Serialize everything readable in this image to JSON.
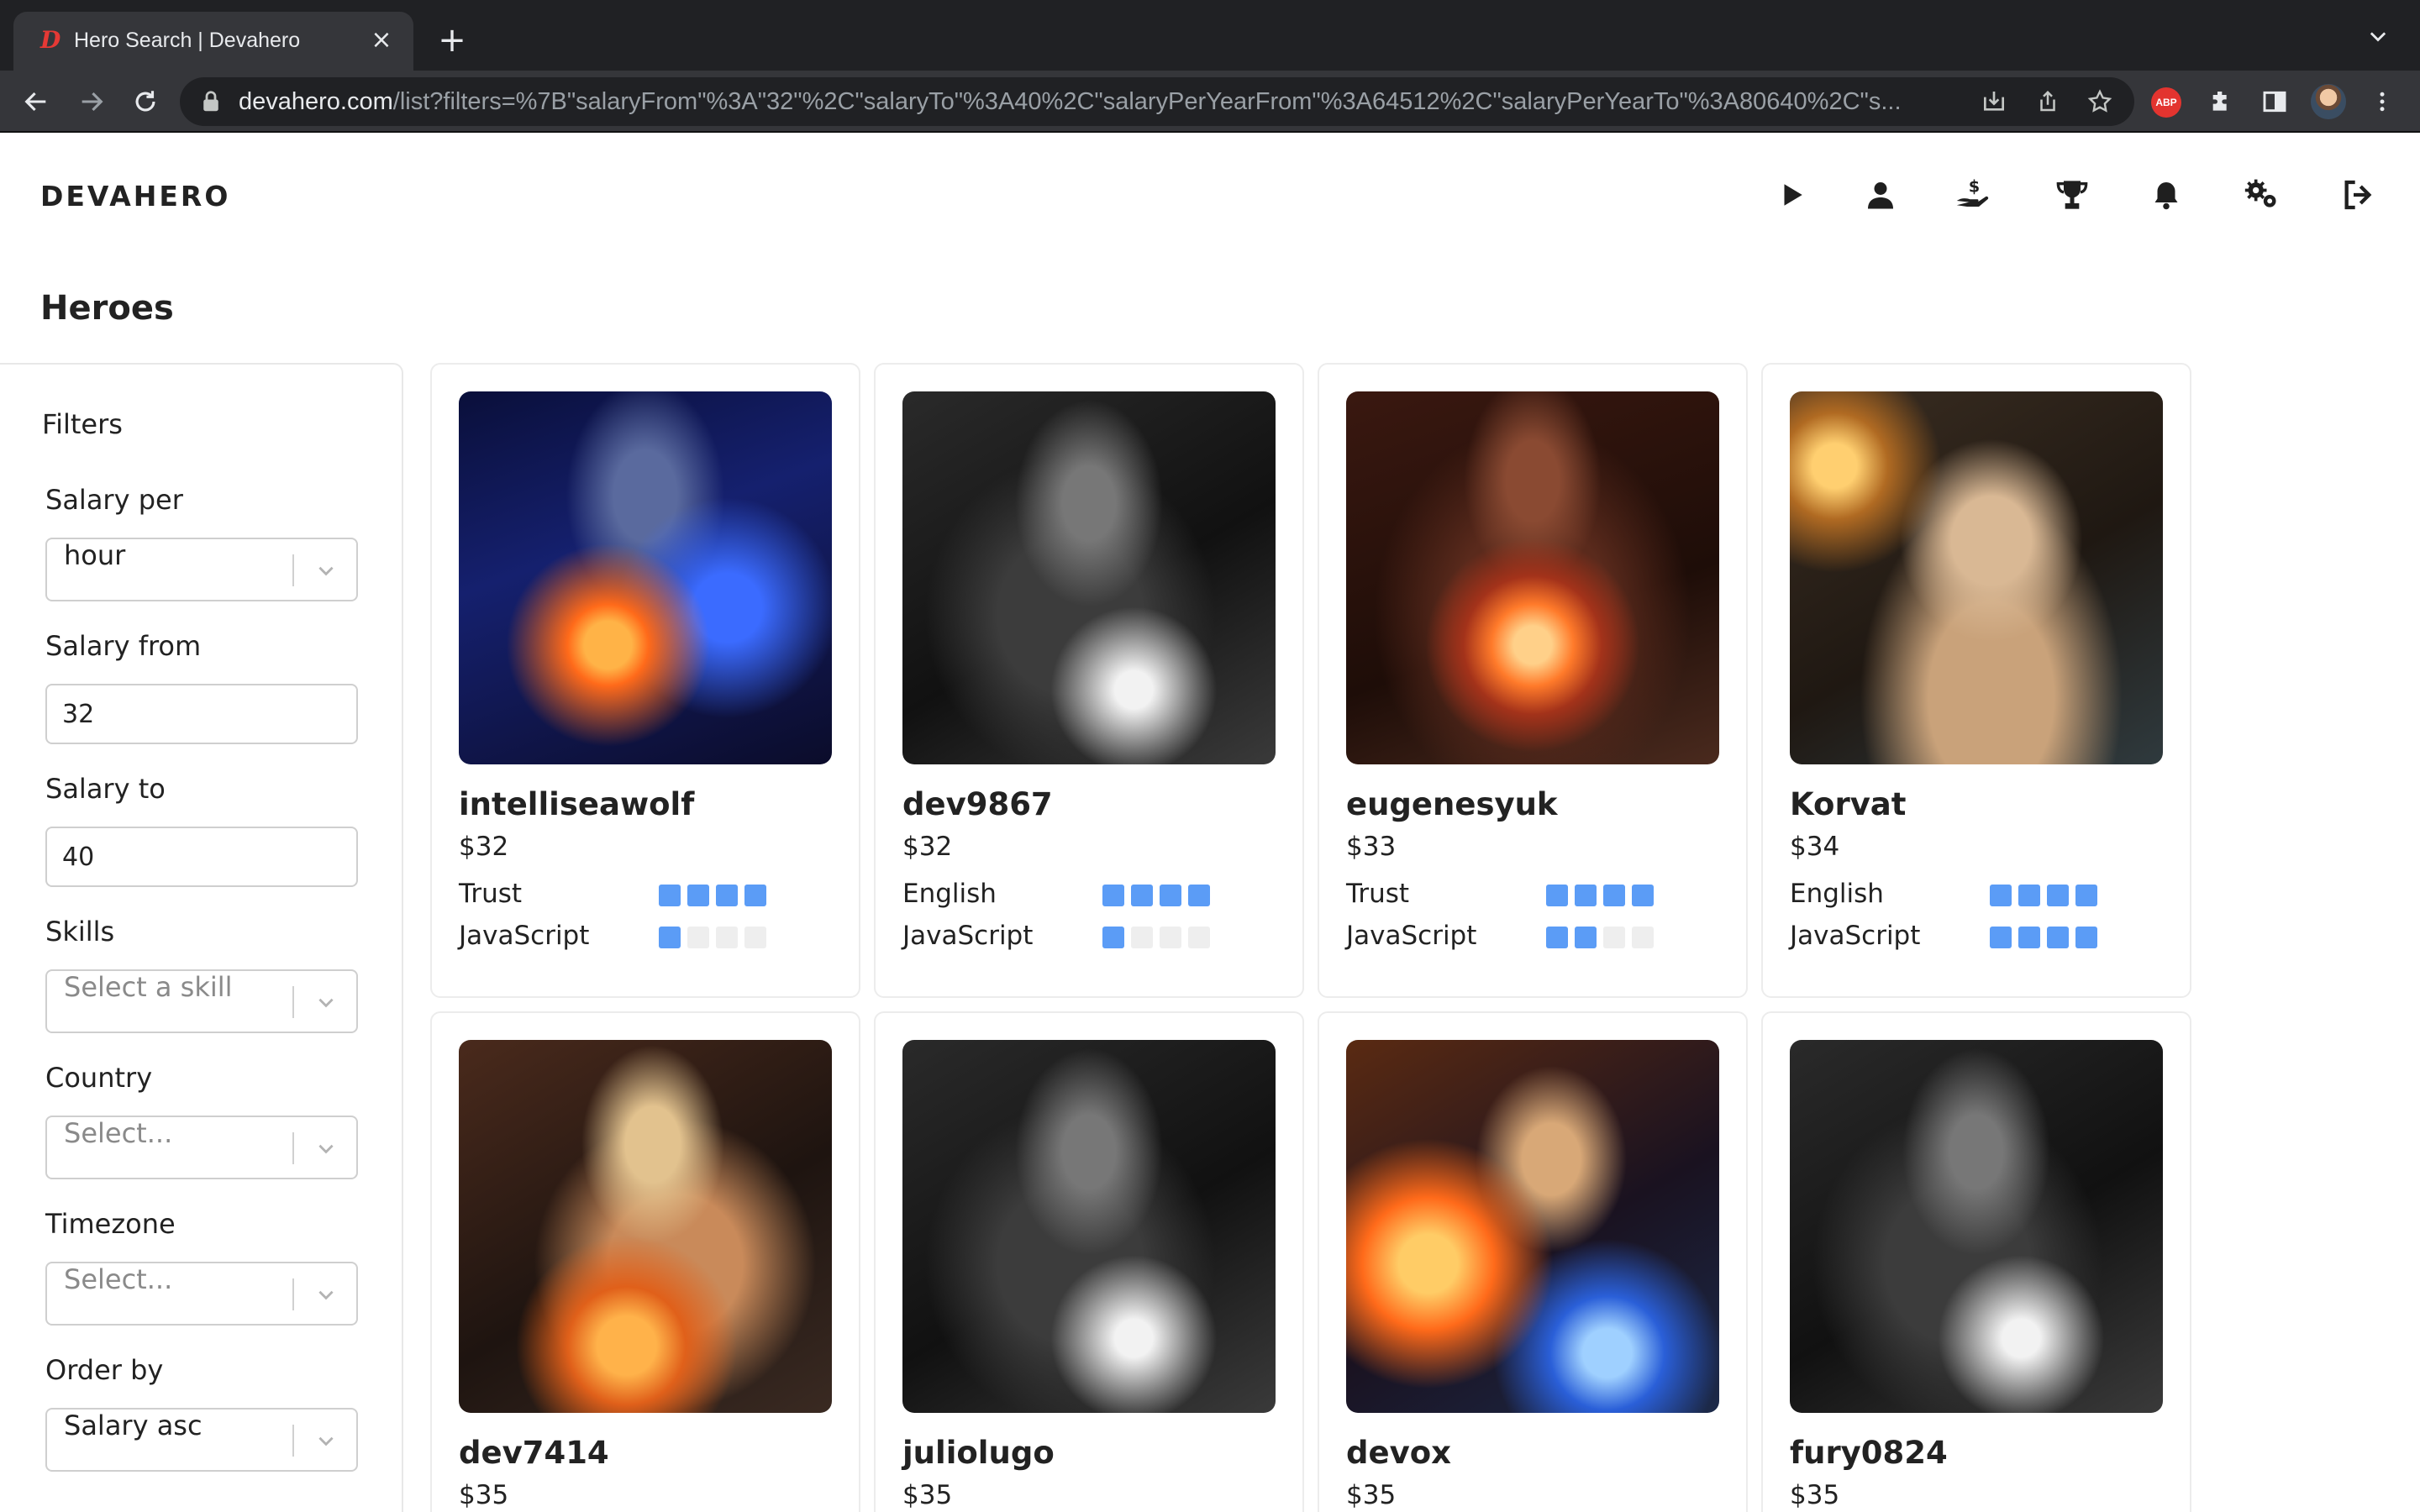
{
  "browser": {
    "tab_title": "Hero Search | Devahero",
    "favicon_letter": "D",
    "url_host": "devahero.com",
    "url_path": "/list?filters=%7B\"salaryFrom\"%3A\"32\"%2C\"salaryTo\"%3A40%2C\"salaryPerYearFrom\"%3A64512%2C\"salaryPerYearTo\"%3A80640%2C\"s...",
    "abp_label": "ABP"
  },
  "app": {
    "brand": "DEVAHERO",
    "nav_icons": [
      "play-icon",
      "user-icon",
      "hand-coin-icon",
      "trophy-icon",
      "bell-icon",
      "gears-icon",
      "logout-icon"
    ]
  },
  "page": {
    "title": "Heroes"
  },
  "filters": {
    "title": "Filters",
    "salary_per": {
      "label": "Salary per",
      "value": "hour"
    },
    "salary_from": {
      "label": "Salary from",
      "value": "32"
    },
    "salary_to": {
      "label": "Salary to",
      "value": "40"
    },
    "skills": {
      "label": "Skills",
      "placeholder": "Select a skill"
    },
    "country": {
      "label": "Country",
      "placeholder": "Select..."
    },
    "timezone": {
      "label": "Timezone",
      "placeholder": "Select..."
    },
    "order_by": {
      "label": "Order by",
      "value": "Salary asc"
    }
  },
  "heroes": [
    {
      "name": "intelliseawolf",
      "rate": "$32",
      "skills": [
        {
          "name": "Trust",
          "level": 4
        },
        {
          "name": "JavaScript",
          "level": 1
        }
      ]
    },
    {
      "name": "dev9867",
      "rate": "$32",
      "skills": [
        {
          "name": "English",
          "level": 4
        },
        {
          "name": "JavaScript",
          "level": 1
        }
      ]
    },
    {
      "name": "eugenesyuk",
      "rate": "$33",
      "skills": [
        {
          "name": "Trust",
          "level": 4
        },
        {
          "name": "JavaScript",
          "level": 2
        }
      ]
    },
    {
      "name": "Korvat",
      "rate": "$34",
      "skills": [
        {
          "name": "English",
          "level": 4
        },
        {
          "name": "JavaScript",
          "level": 4
        }
      ]
    },
    {
      "name": "dev7414",
      "rate": "$35",
      "skills": []
    },
    {
      "name": "juliolugo",
      "rate": "$35",
      "skills": []
    },
    {
      "name": "devox",
      "rate": "$35",
      "skills": []
    },
    {
      "name": "fury0824",
      "rate": "$35",
      "skills": []
    }
  ],
  "skill_level_max": 4,
  "colors": {
    "pip_on": "#5b9cf6",
    "pip_off": "#eeeeee",
    "brand_text": "#222222"
  }
}
